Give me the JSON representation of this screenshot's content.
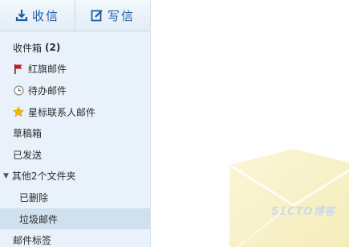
{
  "toolbar": {
    "receive_label": "收信",
    "compose_label": "写信"
  },
  "nav": {
    "inbox": {
      "label": "收件箱",
      "count": "(2)"
    },
    "flagged": {
      "label": "红旗邮件"
    },
    "todo": {
      "label": "待办邮件"
    },
    "starred": {
      "label": "星标联系人邮件"
    },
    "drafts": {
      "label": "草稿箱"
    },
    "sent": {
      "label": "已发送"
    },
    "other_folders": {
      "label": "其他2个文件夹"
    },
    "deleted": {
      "label": "已删除"
    },
    "spam": {
      "label": "垃圾邮件"
    },
    "tags": {
      "label": "邮件标签"
    }
  },
  "watermark": {
    "text": "51CTO博客"
  },
  "colors": {
    "accent": "#1d5da2",
    "sidebar_bg": "#e9f2fa",
    "selected_bg": "#cfe0ef",
    "flag": "#c8161d",
    "star": "#f2b705"
  }
}
